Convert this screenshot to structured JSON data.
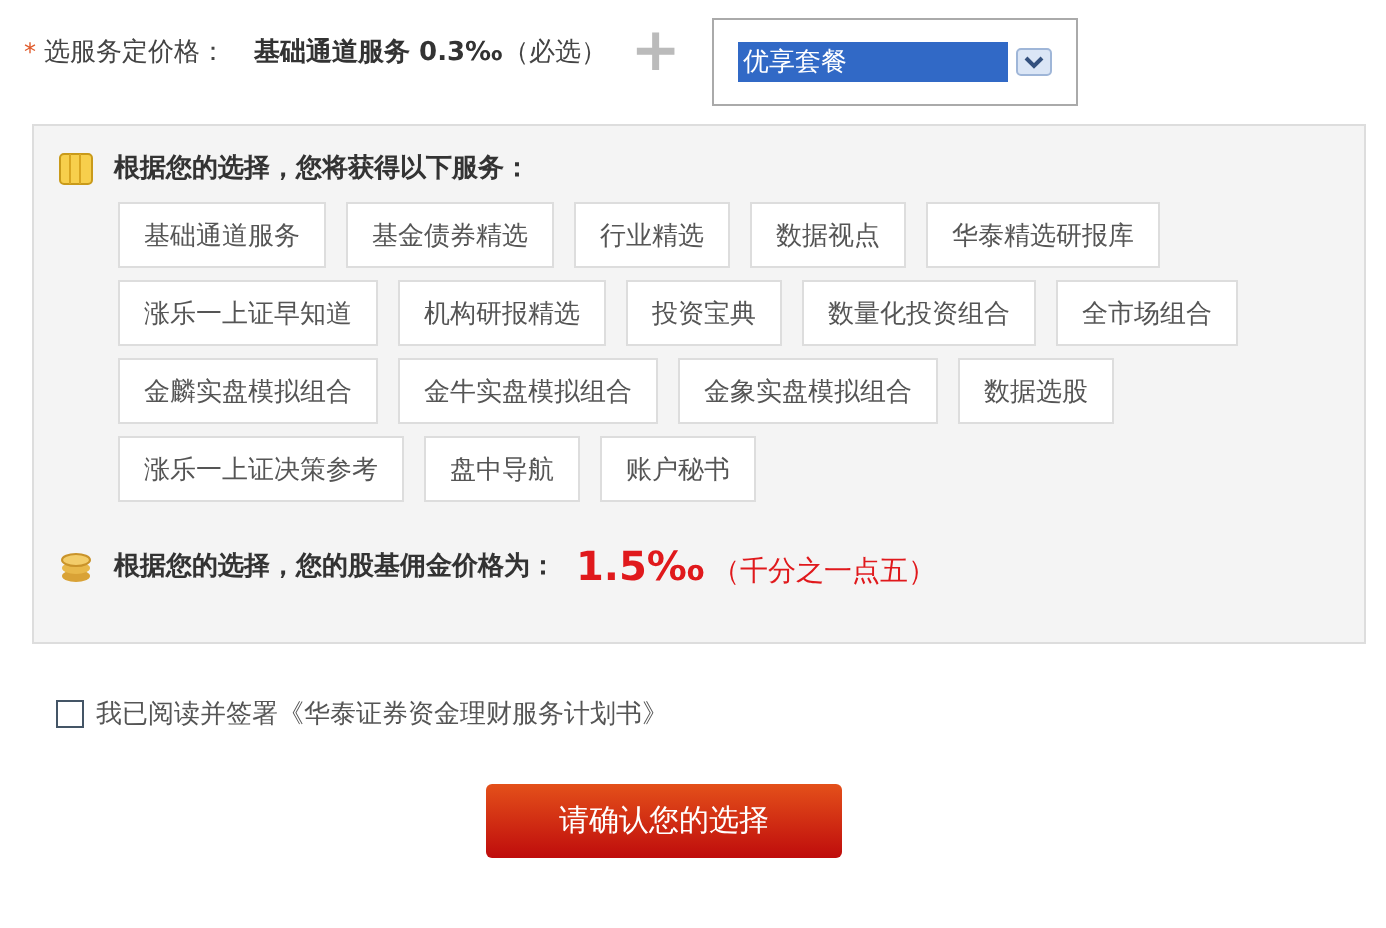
{
  "price_select": {
    "required_mark": "*",
    "label": "选服务定价格：",
    "base_service": "基础通道服务 0.3‰",
    "base_note": "（必选）",
    "plus": "+",
    "package": "优享套餐"
  },
  "services": {
    "heading": "根据您的选择，您将获得以下服务：",
    "rows": [
      [
        "基础通道服务",
        "基金债券精选",
        "行业精选",
        "数据视点",
        "华泰精选研报库"
      ],
      [
        "涨乐一上证早知道",
        "机构研报精选",
        "投资宝典",
        "数量化投资组合",
        "全市场组合"
      ],
      [
        "金麟实盘模拟组合",
        "金牛实盘模拟组合",
        "金象实盘模拟组合",
        "数据选股"
      ],
      [
        "涨乐一上证决策参考",
        "盘中导航",
        "账户秘书"
      ]
    ]
  },
  "commission": {
    "label": "根据您的选择，您的股基佣金价格为：",
    "value": "1.5‰",
    "note": "（千分之一点五）"
  },
  "agreement": {
    "checked": false,
    "text": "我已阅读并签署《华泰证券资金理财服务计划书》"
  },
  "confirm_button": "请确认您的选择"
}
